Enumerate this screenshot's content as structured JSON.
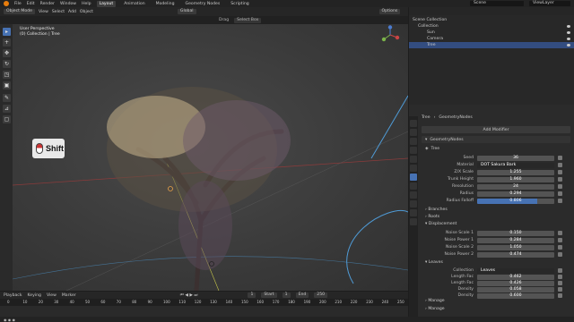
{
  "topbar": {
    "menus": [
      "File",
      "Edit",
      "Render",
      "Window",
      "Help"
    ],
    "workspaces": [
      "Layout",
      "Animation",
      "Modeling",
      "Geometry Nodes",
      "Scripting"
    ],
    "active_workspace": "Layout",
    "scene": "Scene",
    "view_layer": "ViewLayer"
  },
  "viewport_header": {
    "mode": "Object Mode",
    "menus": [
      "View",
      "Select",
      "Add",
      "Object"
    ],
    "orientation": "Global",
    "options": "Options",
    "drag": "Drag",
    "select_box": "Select Box"
  },
  "viewport": {
    "perspective": "User Perspective",
    "collection": "(0) Collection | Tree",
    "key_hint": "Shift"
  },
  "timeline": {
    "menus": [
      "Playback",
      "Keying",
      "View",
      "Marker"
    ],
    "current_frame": "1",
    "start_label": "Start",
    "start": "1",
    "end_label": "End",
    "end": "250",
    "ticks": [
      "0",
      "10",
      "20",
      "30",
      "40",
      "50",
      "60",
      "70",
      "80",
      "90",
      "100",
      "110",
      "120",
      "130",
      "140",
      "150",
      "160",
      "170",
      "180",
      "190",
      "200",
      "210",
      "220",
      "230",
      "240",
      "250"
    ]
  },
  "outliner": {
    "scene_collection": "Scene Collection",
    "collection": "Collection",
    "items": [
      "Sun",
      "Camera",
      "Tree"
    ]
  },
  "properties": {
    "object": "Tree",
    "modifier_name": "GeometryNodes",
    "add_modifier": "Add Modifier",
    "node_group": "GeometryNodes",
    "tree_label": "Tree",
    "fields": [
      {
        "label": "Seed",
        "value": "36"
      },
      {
        "label": "Material",
        "value": "DOT Sakura Bark"
      },
      {
        "label": "Z/X Scale",
        "value": "1.255"
      },
      {
        "label": "Trunk Height",
        "value": "1.960"
      },
      {
        "label": "Resolution",
        "value": "24"
      },
      {
        "label": "Radius",
        "value": "0.294"
      },
      {
        "label": "Radius Falloff",
        "value": "0.806"
      }
    ],
    "sections": [
      "Branches",
      "Roots",
      "Displacement"
    ],
    "displacement": [
      {
        "label": "Noise Scale 1",
        "value": "0.150"
      },
      {
        "label": "Noise Power 1",
        "value": "0.284"
      },
      {
        "label": "Noise Scale 2",
        "value": "1.050"
      },
      {
        "label": "Noise Power 2",
        "value": "0.474"
      }
    ],
    "leaves_section": "Leaves",
    "leaves": [
      {
        "label": "Collection",
        "value": "Leaves"
      },
      {
        "label": "Length Fac",
        "value": "0.462"
      },
      {
        "label": "Length Fac",
        "value": "0.426"
      },
      {
        "label": "Density",
        "value": "0.058"
      },
      {
        "label": "Density",
        "value": "0.600"
      }
    ],
    "more_sections": [
      "Manage",
      "Manage"
    ]
  },
  "colors": {
    "accent": "#4772b3",
    "blender_orange": "#e87d0d",
    "outliner_selected": "#334d80"
  }
}
